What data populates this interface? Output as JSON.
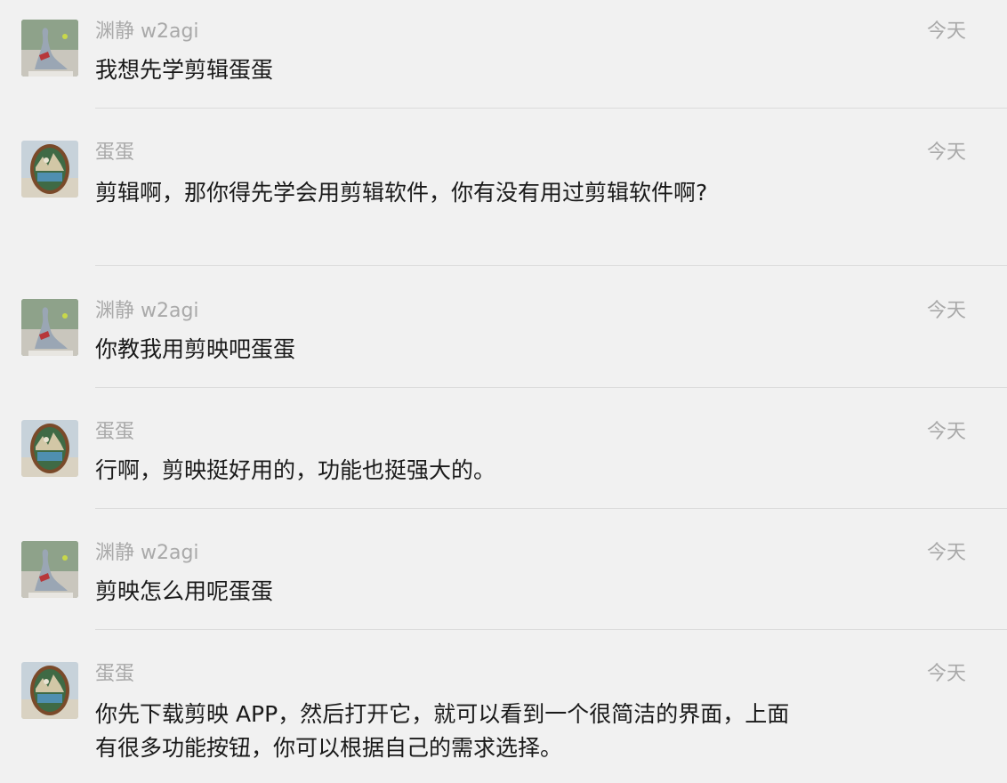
{
  "messages": [
    {
      "sender": "渊静 w2agi",
      "time": "今天",
      "text": "我想先学剪辑蛋蛋",
      "avatar": "user-avatar"
    },
    {
      "sender": "蛋蛋",
      "time": "今天",
      "text": "剪辑啊，那你得先学会用剪辑软件，你有没有用过剪辑软件啊?",
      "avatar": "bot-avatar"
    },
    {
      "sender": "渊静 w2agi",
      "time": "今天",
      "text": "你教我用剪映吧蛋蛋",
      "avatar": "user-avatar"
    },
    {
      "sender": "蛋蛋",
      "time": "今天",
      "text": "行啊，剪映挺好用的，功能也挺强大的。",
      "avatar": "bot-avatar"
    },
    {
      "sender": "渊静 w2agi",
      "time": "今天",
      "text": "剪映怎么用呢蛋蛋",
      "avatar": "user-avatar"
    },
    {
      "sender": "蛋蛋",
      "time": "今天",
      "text": "你先下载剪映 APP，然后打开它，就可以看到一个很简洁的界面，上面有很多功能按钮，你可以根据自己的需求选择。",
      "avatar": "bot-avatar"
    }
  ]
}
